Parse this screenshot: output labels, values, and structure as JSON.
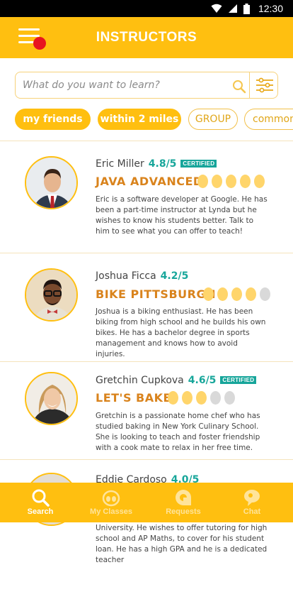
{
  "status_bar": {
    "time": "12:30"
  },
  "header": {
    "title": "INSTRUCTORS"
  },
  "search": {
    "placeholder": "What do you want to learn?"
  },
  "chips": [
    {
      "label": "my friends",
      "active": true
    },
    {
      "label": "within 2 miles",
      "active": true
    },
    {
      "label": "GROUP",
      "active": false
    },
    {
      "label": "common",
      "active": false
    }
  ],
  "instructors": [
    {
      "name": "Eric Miller",
      "rating": "4.8/5",
      "certified": true,
      "certified_label": "CERTIFIED",
      "course": "JAVA ADVANCED",
      "pips_filled": 5,
      "pips_total": 5,
      "bio": "Eric is a software developer at Google. He has been a part-time instructor at Lynda but he wishes to know his students better. Talk to him to see what you can offer to teach!"
    },
    {
      "name": "Joshua Ficca",
      "rating": "4.2/5",
      "certified": false,
      "course": "BIKE PITTSBURGH",
      "pips_filled": 4,
      "pips_total": 5,
      "bio": "Joshua is a biking enthusiast. He has been biking from high school and he builds his own bikes. He has a bachelor degree in sports management and knows how to avoid injuries."
    },
    {
      "name": "Gretchin Cupkova",
      "rating": "4.6/5",
      "certified": true,
      "certified_label": "CERTIFIED",
      "course": "LET'S BAKE",
      "pips_filled": 3,
      "pips_total": 5,
      "bio": "Gretchin is a passionate home chef who has studied baking in New York Culinary School. She is looking to teach and foster friendship with a cook mate to relax in her free time."
    },
    {
      "name": "Eddie Cardoso",
      "rating": "4.0/5",
      "bio_visible": "University. He wishes to offer tutoring for high school and AP Maths, to cover for his student loan. He has a high GPA and he is a dedicated teacher"
    }
  ],
  "bottom_nav": [
    {
      "label": "Search",
      "icon": "search-icon",
      "active": true
    },
    {
      "label": "My Classes",
      "icon": "classes-icon",
      "active": false
    },
    {
      "label": "Requests",
      "icon": "requests-icon",
      "active": false
    },
    {
      "label": "Chat",
      "icon": "chat-icon",
      "active": false
    }
  ],
  "colors": {
    "brand": "#FFBF10",
    "accent_orange": "#D9831C",
    "rating_teal": "#17A69A",
    "notification_red": "#E8141F"
  }
}
